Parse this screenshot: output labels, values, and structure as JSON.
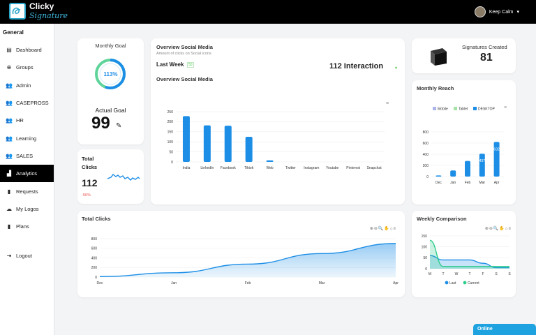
{
  "brand": {
    "line1": "Clicky",
    "line2": "Signature"
  },
  "user": {
    "name": "Keep Calm"
  },
  "sidebar": {
    "section": "General",
    "items": [
      {
        "label": "Dashboard",
        "icon": "dashboard-icon",
        "glyph": "▤"
      },
      {
        "label": "Groups",
        "icon": "plus-circle-icon",
        "glyph": "⊕"
      },
      {
        "label": "Admin",
        "icon": "users-icon",
        "glyph": "👥"
      },
      {
        "label": "CASEPROSS",
        "icon": "users-icon",
        "glyph": "👥"
      },
      {
        "label": "HR",
        "icon": "users-icon",
        "glyph": "👥"
      },
      {
        "label": "Learning",
        "icon": "users-icon",
        "glyph": "👥"
      },
      {
        "label": "SALES",
        "icon": "users-icon",
        "glyph": "👥"
      },
      {
        "label": "Analytics",
        "icon": "bar-chart-icon",
        "glyph": "▟",
        "active": true
      },
      {
        "label": "Requests",
        "icon": "document-icon",
        "glyph": "▮"
      },
      {
        "label": "My Logos",
        "icon": "cloud-icon",
        "glyph": "☁"
      },
      {
        "label": "Plans",
        "icon": "document-icon",
        "glyph": "▮"
      }
    ],
    "logout": "Logout"
  },
  "monthly_goal": {
    "title": "Monthly Goal",
    "percent_label": "113%",
    "percent": 113,
    "actual_title": "Actual Goal",
    "actual_value": "99"
  },
  "total_clicks_card": {
    "title": "Total Clicks",
    "value": "112",
    "change": "-56%"
  },
  "overview": {
    "title": "Overview Social Media",
    "subtitle": "Amount of clicks on Social icons",
    "period": "Last Week",
    "period_badge": "50",
    "interaction": "112 Interaction",
    "chart_title": "Overview Social Media"
  },
  "signatures": {
    "title": "Signatures Created",
    "value": "81"
  },
  "monthly_reach": {
    "title": "Monthly Reach"
  },
  "total_clicks_chart": {
    "title": "Total Clicks"
  },
  "weekly": {
    "title": "Weekly Comparison"
  },
  "online": "Online",
  "colors": {
    "accent": "#1c8ee6",
    "green": "#2ecc8a",
    "dark": "#000000"
  },
  "chart_data": [
    {
      "type": "bar",
      "categories": [
        "India",
        "LinkedIn",
        "Facebook",
        "Tiktok",
        "Web",
        "Twitter",
        "Instagram",
        "Youtube",
        "Pinterest",
        "Snapchat"
      ],
      "values": [
        228,
        182,
        180,
        125,
        8,
        0,
        0,
        0,
        0,
        0
      ],
      "ylim": [
        0,
        250
      ],
      "yticks": [
        "250",
        "200",
        "150",
        "100",
        "50",
        "0"
      ]
    },
    {
      "type": "bar",
      "categories": [
        "Dec",
        "Jan",
        "Feb",
        "Mar",
        "Apr"
      ],
      "legend": [
        "Mobile",
        "Tablet",
        "DESKTOP"
      ],
      "series": [
        {
          "name": "DESKTOP",
          "values": [
            20,
            110,
            280,
            410,
            620
          ]
        }
      ],
      "data_labels": [
        "",
        "",
        "",
        "437",
        "632"
      ],
      "ylim": [
        0,
        800
      ],
      "yticks": [
        "800",
        "600",
        "400",
        "200",
        "0"
      ]
    },
    {
      "type": "area",
      "categories": [
        "Dec",
        "Jan",
        "Feb",
        "Mar",
        "Apr"
      ],
      "values": [
        10,
        90,
        270,
        490,
        700
      ],
      "ylim": [
        0,
        800
      ],
      "yticks": [
        "800",
        "600",
        "400",
        "200",
        "0"
      ]
    },
    {
      "type": "line",
      "categories": [
        "M",
        "T",
        "W",
        "T",
        "F",
        "S",
        "S"
      ],
      "series": [
        {
          "name": "Last",
          "values": [
            60,
            40,
            40,
            40,
            25,
            5,
            5
          ]
        },
        {
          "name": "Current",
          "values": [
            130,
            10,
            10,
            10,
            10,
            10,
            10
          ]
        }
      ],
      "ylim": [
        0,
        150
      ],
      "yticks": [
        "150",
        "100",
        "50",
        "0"
      ]
    }
  ]
}
